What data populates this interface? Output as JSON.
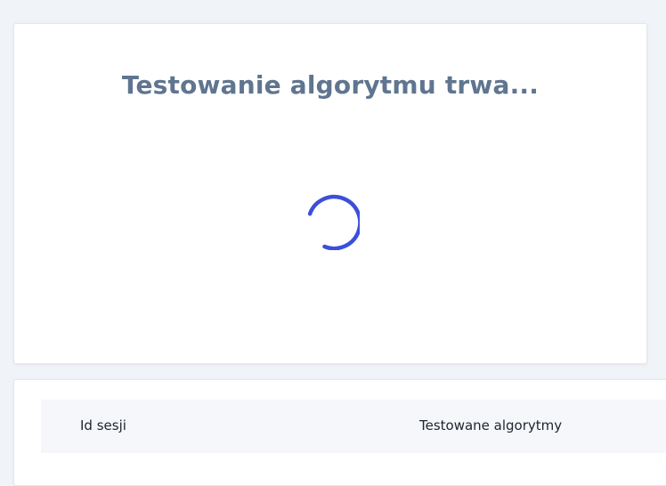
{
  "loading": {
    "title": "Testowanie algorytmu trwa...",
    "spinner_icon": "loading-spinner-icon",
    "spinner_color": "#3b4fd9",
    "title_color": "#5f7590"
  },
  "sessions_table": {
    "columns": [
      "Id sesji",
      "Testowane algorytmy"
    ]
  },
  "colors": {
    "page_background": "#f0f3f8",
    "card_background": "#ffffff",
    "table_header_background": "#f5f7fb"
  }
}
